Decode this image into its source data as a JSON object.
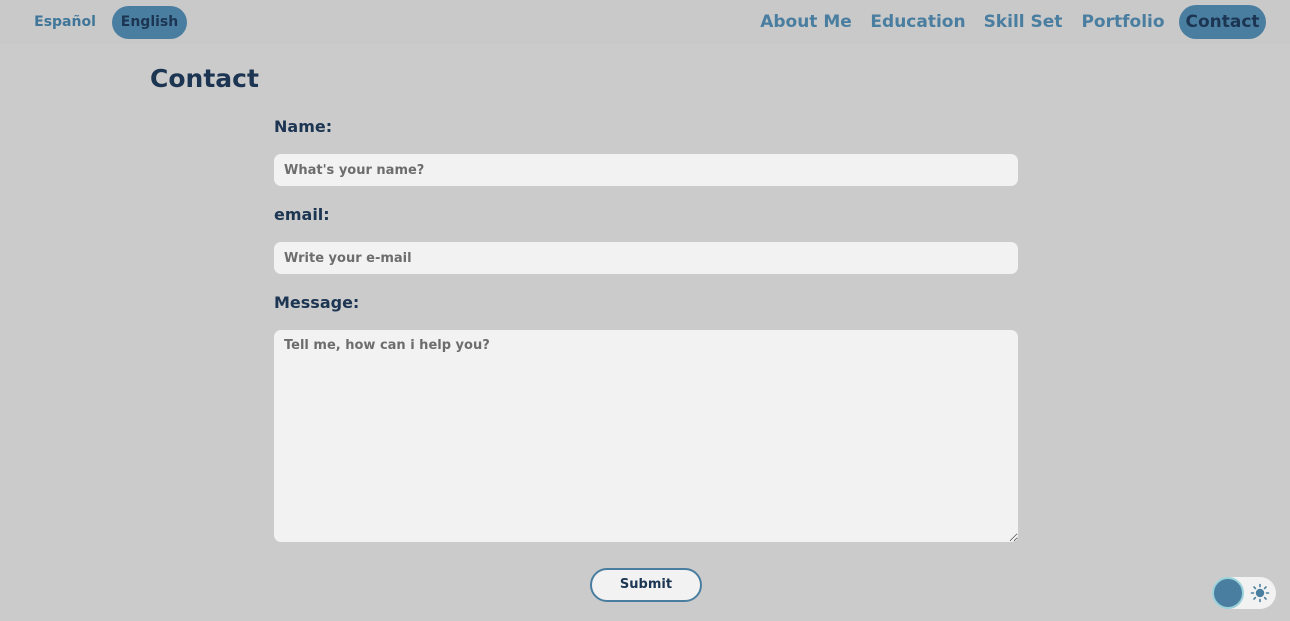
{
  "header": {
    "languages": [
      {
        "label": "Español",
        "active": false
      },
      {
        "label": "English",
        "active": true
      }
    ],
    "nav": [
      {
        "label": "About Me",
        "active": false
      },
      {
        "label": "Education",
        "active": false
      },
      {
        "label": "Skill Set",
        "active": false
      },
      {
        "label": "Portfolio",
        "active": false
      },
      {
        "label": "Contact",
        "active": true
      }
    ]
  },
  "page": {
    "title": "Contact"
  },
  "form": {
    "name_label": "Name:",
    "name_placeholder": "What's your name?",
    "name_value": "",
    "email_label": "email:",
    "email_placeholder": "Write your e-mail",
    "email_value": "",
    "message_label": "Message:",
    "message_placeholder": "Tell me, how can i help you?",
    "message_value": "",
    "submit_label": "Submit"
  },
  "theme_toggle": {
    "icon": "sun-icon",
    "mode": "light"
  },
  "colors": {
    "background": "#cbcbcb",
    "accent": "#4a7ea0",
    "heading": "#1c3552",
    "field_bg": "#f2f2f2"
  }
}
